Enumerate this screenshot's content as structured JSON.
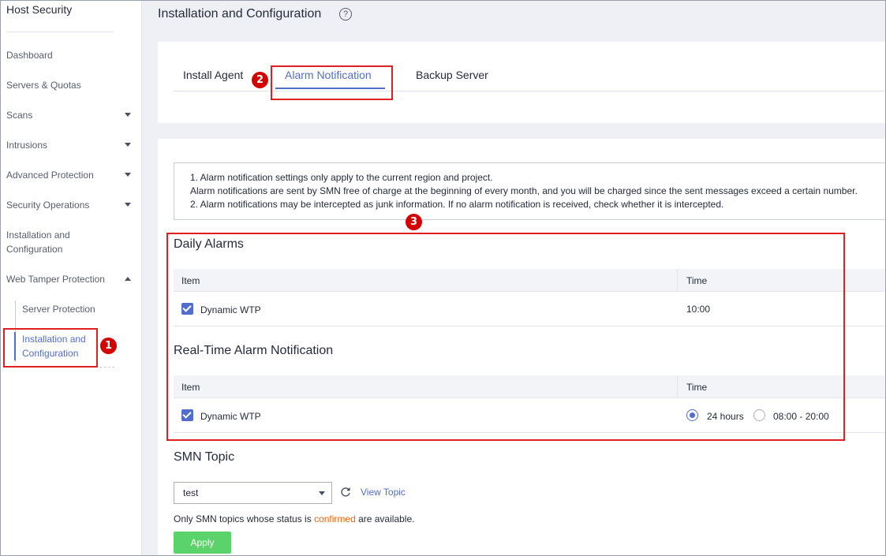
{
  "sidebar": {
    "title": "Host Security",
    "items": [
      {
        "label": "Dashboard"
      },
      {
        "label": "Servers & Quotas"
      },
      {
        "label": "Scans"
      },
      {
        "label": "Intrusions"
      },
      {
        "label": "Advanced Protection"
      },
      {
        "label": "Security Operations"
      },
      {
        "label": "Installation and Configuration"
      },
      {
        "label": "Web Tamper Protection"
      }
    ],
    "sub_items": [
      {
        "label": "Server Protection"
      },
      {
        "label": "Installation and Configuration"
      }
    ]
  },
  "badges": [
    "1",
    "2",
    "3"
  ],
  "header": {
    "title": "Installation and Configuration",
    "help_glyph": "?"
  },
  "tabs": [
    {
      "label": "Install Agent"
    },
    {
      "label": "Alarm Notification"
    },
    {
      "label": "Backup Server"
    }
  ],
  "notice": {
    "line1": "1. Alarm notification settings only apply to the current region and project.",
    "line2": "Alarm notifications are sent by SMN free of charge at the beginning of every month, and you will be charged since the sent messages exceed a certain number.",
    "line3": "2. Alarm notifications may be intercepted as junk information. If no alarm notification is received, check whether it is intercepted."
  },
  "daily": {
    "title": "Daily Alarms",
    "columns": [
      "Item",
      "Time"
    ],
    "rows": [
      {
        "item": "Dynamic WTP",
        "time": "10:00"
      }
    ]
  },
  "realtime": {
    "title": "Real-Time Alarm Notification",
    "columns": [
      "Item",
      "Time"
    ],
    "rows": [
      {
        "item": "Dynamic WTP",
        "option1": "24 hours",
        "option2": "08:00 - 20:00",
        "selected": "24 hours"
      }
    ]
  },
  "smn": {
    "title": "SMN Topic",
    "selected": "test",
    "view_topic": "View Topic",
    "hint_before": "Only SMN topics whose status is ",
    "hint_warn": "confirmed",
    "hint_after": " are available.",
    "apply": "Apply"
  },
  "colors": {
    "accent": "#526ecc",
    "annotation": "#e02020",
    "badge": "#d40000",
    "apply": "#5ad36b",
    "warn": "#fa6400"
  }
}
